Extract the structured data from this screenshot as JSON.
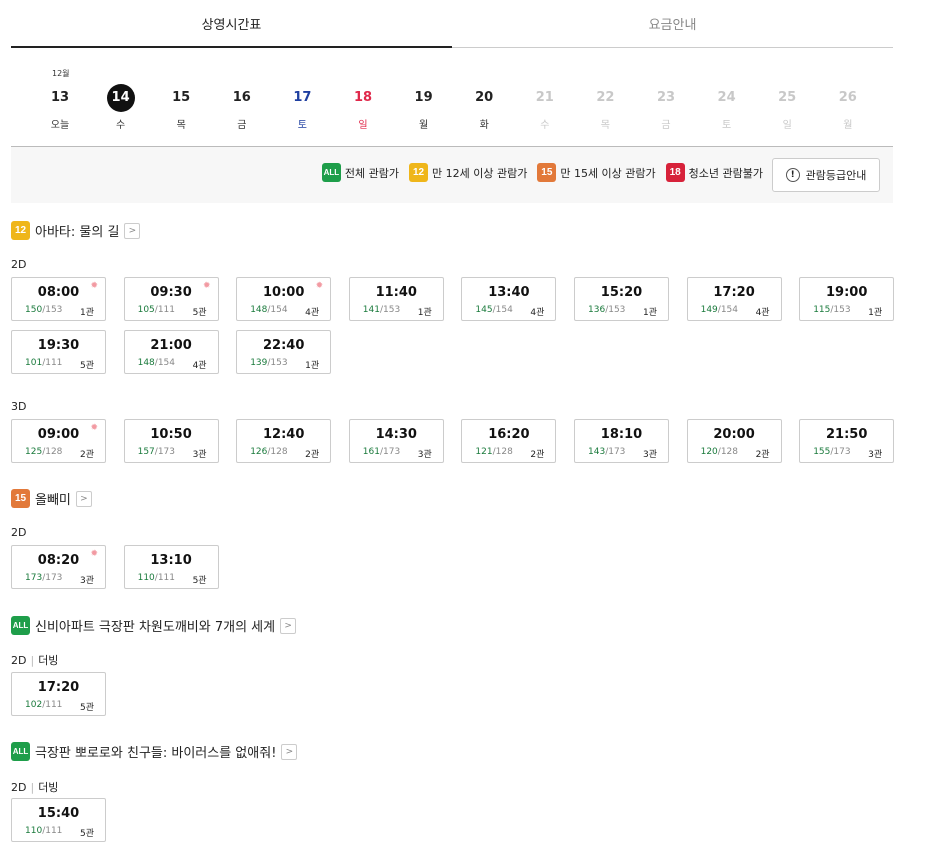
{
  "tabs": [
    {
      "label": "상영시간표",
      "active": true
    },
    {
      "label": "요금안내",
      "active": false
    }
  ],
  "month_label": "12월",
  "dates": [
    {
      "num": "13",
      "wd": "오늘",
      "kind": "normal"
    },
    {
      "num": "14",
      "wd": "수",
      "kind": "sel"
    },
    {
      "num": "15",
      "wd": "목",
      "kind": "normal"
    },
    {
      "num": "16",
      "wd": "금",
      "kind": "normal"
    },
    {
      "num": "17",
      "wd": "토",
      "kind": "sat"
    },
    {
      "num": "18",
      "wd": "일",
      "kind": "sun"
    },
    {
      "num": "19",
      "wd": "월",
      "kind": "normal"
    },
    {
      "num": "20",
      "wd": "화",
      "kind": "normal"
    },
    {
      "num": "21",
      "wd": "수",
      "kind": "dis"
    },
    {
      "num": "22",
      "wd": "목",
      "kind": "dis"
    },
    {
      "num": "23",
      "wd": "금",
      "kind": "dis"
    },
    {
      "num": "24",
      "wd": "토",
      "kind": "dis"
    },
    {
      "num": "25",
      "wd": "일",
      "kind": "dis"
    },
    {
      "num": "26",
      "wd": "월",
      "kind": "dis"
    }
  ],
  "legend": {
    "items": [
      {
        "badge": "ALL",
        "cls": "b-all",
        "label": "전체 관람가"
      },
      {
        "badge": "12",
        "cls": "b-12",
        "label": "만 12세 이상 관람가"
      },
      {
        "badge": "15",
        "cls": "b-15",
        "label": "만 15세 이상 관람가"
      },
      {
        "badge": "18",
        "cls": "b-18",
        "label": "청소년 관람불가"
      }
    ],
    "info_icon": "!",
    "rating_button": "관람등급안내"
  },
  "colors": {
    "all": "#1e9e4a",
    "r12": "#efb61a",
    "r15": "#e2793a",
    "r18": "#d7223a",
    "saturday": "#1f3fa0",
    "sunday": "#e0284a",
    "seat_available": "#1a7a3c"
  },
  "movies": [
    {
      "rating": "12",
      "rating_cls": "b-12",
      "title": "아바타: 물의 길",
      "groups": [
        {
          "format": "2D",
          "dub": "",
          "slots": [
            {
              "time": "08:00",
              "avail": "150",
              "total": "/153",
              "hall": "1관",
              "morning": true
            },
            {
              "time": "09:30",
              "avail": "105",
              "total": "/111",
              "hall": "5관",
              "morning": true
            },
            {
              "time": "10:00",
              "avail": "148",
              "total": "/154",
              "hall": "4관",
              "morning": true
            },
            {
              "time": "11:40",
              "avail": "141",
              "total": "/153",
              "hall": "1관",
              "morning": false
            },
            {
              "time": "13:40",
              "avail": "145",
              "total": "/154",
              "hall": "4관",
              "morning": false
            },
            {
              "time": "15:20",
              "avail": "136",
              "total": "/153",
              "hall": "1관",
              "morning": false
            },
            {
              "time": "17:20",
              "avail": "149",
              "total": "/154",
              "hall": "4관",
              "morning": false
            },
            {
              "time": "19:00",
              "avail": "115",
              "total": "/153",
              "hall": "1관",
              "morning": false
            },
            {
              "time": "19:30",
              "avail": "101",
              "total": "/111",
              "hall": "5관",
              "morning": false
            },
            {
              "time": "21:00",
              "avail": "148",
              "total": "/154",
              "hall": "4관",
              "morning": false
            },
            {
              "time": "22:40",
              "avail": "139",
              "total": "/153",
              "hall": "1관",
              "morning": false
            }
          ]
        },
        {
          "format": "3D",
          "dub": "",
          "slots": [
            {
              "time": "09:00",
              "avail": "125",
              "total": "/128",
              "hall": "2관",
              "morning": true
            },
            {
              "time": "10:50",
              "avail": "157",
              "total": "/173",
              "hall": "3관",
              "morning": false
            },
            {
              "time": "12:40",
              "avail": "126",
              "total": "/128",
              "hall": "2관",
              "morning": false
            },
            {
              "time": "14:30",
              "avail": "161",
              "total": "/173",
              "hall": "3관",
              "morning": false
            },
            {
              "time": "16:20",
              "avail": "121",
              "total": "/128",
              "hall": "2관",
              "morning": false
            },
            {
              "time": "18:10",
              "avail": "143",
              "total": "/173",
              "hall": "3관",
              "morning": false
            },
            {
              "time": "20:00",
              "avail": "120",
              "total": "/128",
              "hall": "2관",
              "morning": false
            },
            {
              "time": "21:50",
              "avail": "155",
              "total": "/173",
              "hall": "3관",
              "morning": false
            }
          ]
        }
      ]
    },
    {
      "rating": "15",
      "rating_cls": "b-15",
      "title": "올빼미",
      "groups": [
        {
          "format": "2D",
          "dub": "",
          "slots": [
            {
              "time": "08:20",
              "avail": "173",
              "total": "/173",
              "hall": "3관",
              "morning": true
            },
            {
              "time": "13:10",
              "avail": "110",
              "total": "/111",
              "hall": "5관",
              "morning": false
            }
          ]
        }
      ]
    },
    {
      "rating": "ALL",
      "rating_cls": "b-all",
      "title": "신비아파트 극장판 차원도깨비와 7개의 세계",
      "groups": [
        {
          "format": "2D",
          "dub": "더빙",
          "slots": [
            {
              "time": "17:20",
              "avail": "102",
              "total": "/111",
              "hall": "5관",
              "morning": false
            }
          ]
        }
      ]
    },
    {
      "rating": "ALL",
      "rating_cls": "b-all",
      "title": "극장판 뽀로로와 친구들: 바이러스를 없애줘!",
      "groups": [
        {
          "format": "2D",
          "dub": "더빙",
          "slots": [
            {
              "time": "15:40",
              "avail": "110",
              "total": "/111",
              "hall": "5관",
              "morning": false
            }
          ]
        }
      ]
    }
  ]
}
